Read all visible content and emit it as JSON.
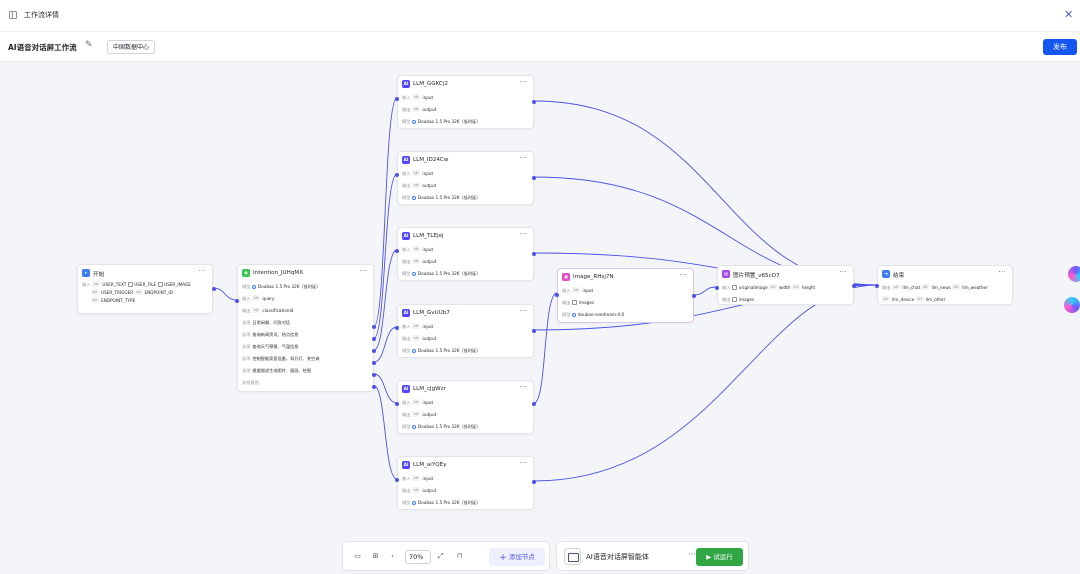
{
  "header": {
    "title": "工作流详情",
    "close_label": "✕"
  },
  "subheader": {
    "workflow_name": "AI语音对话屏工作流",
    "edit_label": "✎",
    "region": "中国数据中心",
    "publish": "发布"
  },
  "nodes": {
    "start": {
      "name": "开始",
      "inputs_label": "输入",
      "fields": [
        "USER_TEXT",
        "USER_FILE",
        "USER_IMAGE",
        "USER_TRIGGER",
        "ENDPOINT_ID",
        "ENDPOINT_TYPE"
      ]
    },
    "intention": {
      "name": "Intention_JUHqMX",
      "model_label": "模型",
      "model": "Doubao 1.5 Pro 32K（低时延）",
      "input_label": "输入",
      "input": "query",
      "output_label": "输出",
      "output": "classificationId",
      "option_label": "选项",
      "options": [
        "日常闲聊、问答对话",
        "查询新闻资讯、热点信息",
        "查询天气预报、气温信息",
        "控制智能家居设备，如开灯、关空调",
        "根据描述生成图片、插画、绘图"
      ],
      "other": "其他意图"
    },
    "llm_labels": {
      "input_label": "输入",
      "input": "input",
      "output_label": "输出",
      "output": "output",
      "model_label": "模型",
      "model": "Doubao 1.5 Pro 32K（低时延）"
    },
    "llm1": {
      "name": "LLM_GGKCj2"
    },
    "llm2": {
      "name": "LLM_ID24Cw"
    },
    "llm3": {
      "name": "LLM_TLEjej"
    },
    "llm4": {
      "name": "LLM_GvUUb7"
    },
    "llm5": {
      "name": "LLM_cJgWzr"
    },
    "llm6": {
      "name": "LLM_aiYQEy"
    },
    "image": {
      "name": "Image_RHsj7N",
      "input_label": "输入",
      "input": "input",
      "output_label": "输出",
      "output": "images",
      "model_label": "模型",
      "model": "doubao-seedream-4.0"
    },
    "preview": {
      "name": "图片预置_v65cO7",
      "input_label": "输入",
      "inputs": [
        "originalImage",
        "width",
        "height"
      ],
      "output_label": "输出",
      "output": "images"
    },
    "end": {
      "name": "结束",
      "output_label": "输出",
      "outputs": [
        "llm_chat",
        "llm_news",
        "llm_weather",
        "llm_device",
        "llm_other"
      ]
    }
  },
  "toolbar": {
    "zoom": "70%",
    "add_node": "添加节点"
  },
  "agent": {
    "name": "AI语音对话屏智能体",
    "more": "···",
    "run": "试运行"
  },
  "colors": {
    "accent": "#4d53e8",
    "publish": "#1456f0",
    "run": "#32a645",
    "llm_icon": "#5147ff",
    "intention_icon": "#3ec254",
    "image_icon": "#e94bc8",
    "start_icon": "#3c7ef8"
  }
}
